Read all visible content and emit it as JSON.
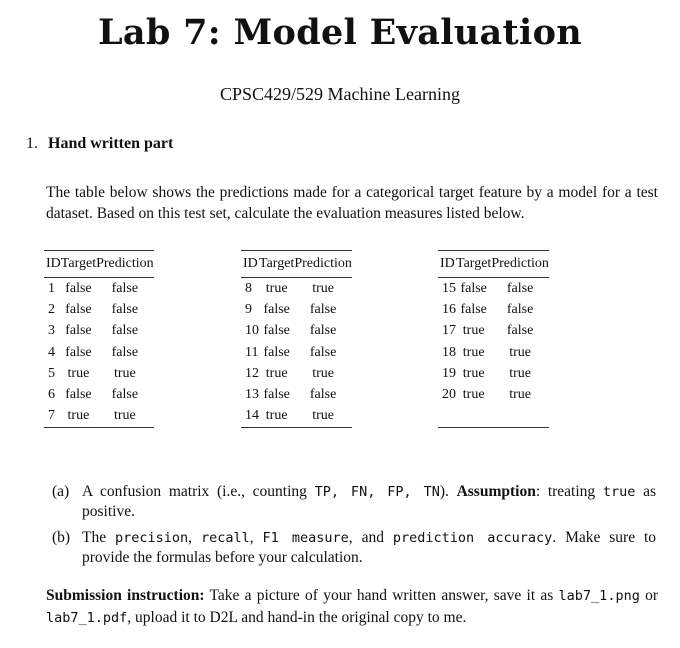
{
  "title": "Lab 7: Model Evaluation",
  "subtitle": "CPSC429/529 Machine Learning",
  "section": {
    "number": "1.",
    "heading": "Hand written part"
  },
  "intro": "The table below shows the predictions made for a categorical target feature by a model for a test dataset. Based on this test set, calculate the evaluation measures listed below.",
  "table": {
    "headers": [
      "ID",
      "Target",
      "Prediction"
    ],
    "blocks": [
      {
        "rows": [
          [
            "1",
            "false",
            "false"
          ],
          [
            "2",
            "false",
            "false"
          ],
          [
            "3",
            "false",
            "false"
          ],
          [
            "4",
            "false",
            "false"
          ],
          [
            "5",
            "true",
            "true"
          ],
          [
            "6",
            "false",
            "false"
          ],
          [
            "7",
            "true",
            "true"
          ]
        ]
      },
      {
        "rows": [
          [
            "8",
            "true",
            "true"
          ],
          [
            "9",
            "false",
            "false"
          ],
          [
            "10",
            "false",
            "false"
          ],
          [
            "11",
            "false",
            "false"
          ],
          [
            "12",
            "true",
            "true"
          ],
          [
            "13",
            "false",
            "false"
          ],
          [
            "14",
            "true",
            "true"
          ]
        ]
      },
      {
        "rows": [
          [
            "15",
            "false",
            "false"
          ],
          [
            "16",
            "false",
            "false"
          ],
          [
            "17",
            "true",
            "false"
          ],
          [
            "18",
            "true",
            "true"
          ],
          [
            "19",
            "true",
            "true"
          ],
          [
            "20",
            "true",
            "true"
          ]
        ]
      }
    ]
  },
  "items": {
    "a": {
      "label": "(a)",
      "text1": "A confusion matrix (i.e., counting ",
      "code1": "TP, FN, FP, TN",
      "text2": "). ",
      "bold1": "Assumption",
      "text3": ": treating ",
      "code2": "true",
      "text4": " as positive."
    },
    "b": {
      "label": "(b)",
      "text1": "The ",
      "code1": "precision",
      "text2": ", ",
      "code2": "recall",
      "text3": ", ",
      "code3": "F1 measure",
      "text4": ", and ",
      "code4": "prediction accuracy",
      "text5": ". Make sure to provide the formulas before your calculation."
    }
  },
  "submission": {
    "bold": "Submission instruction:",
    "text1": " Take a picture of your hand written answer, save it as ",
    "file1": "lab7_1.png",
    "text2": " or ",
    "file2": "lab7_1.pdf",
    "text3": ", upload it to D2L and hand-in the original copy to me."
  }
}
